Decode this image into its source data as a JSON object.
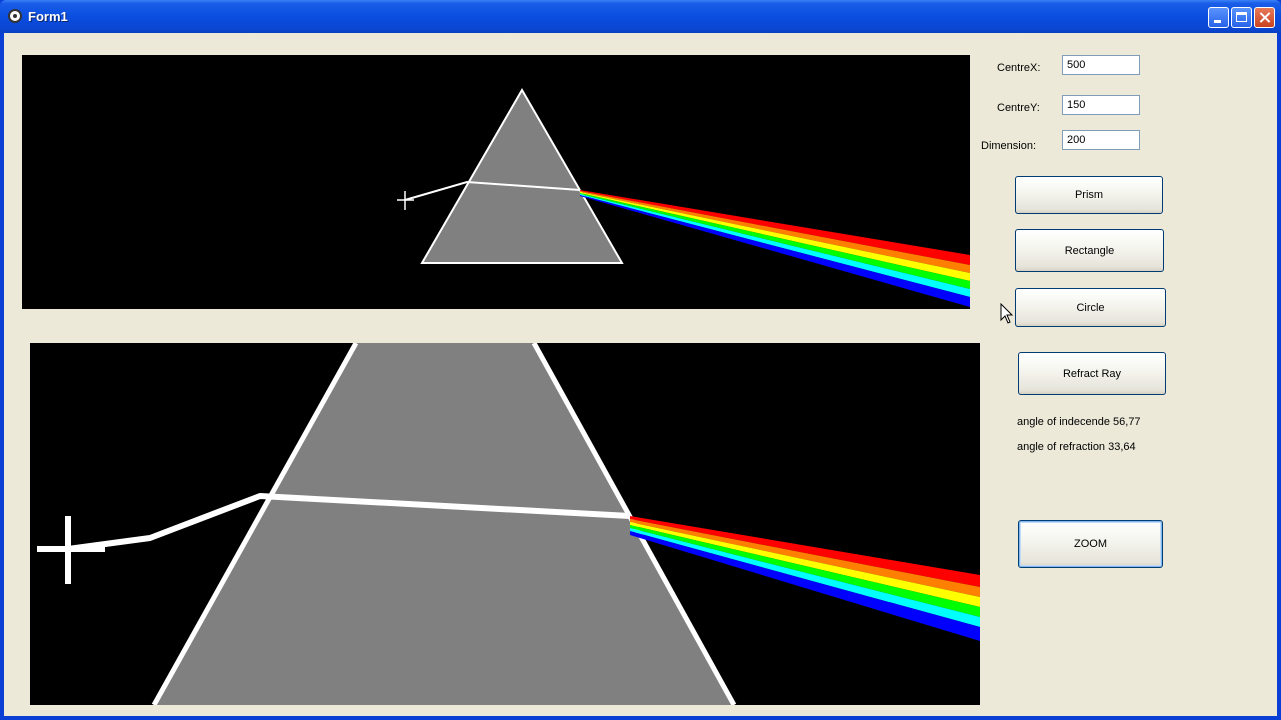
{
  "window": {
    "title": "Form1"
  },
  "icons": {
    "app": "app-icon",
    "minimize": "minimize-icon",
    "maximize": "maximize-icon",
    "close": "close-icon",
    "cursor": "mouse-pointer-icon"
  },
  "colors": {
    "canvas_background": "#000000",
    "prism_fill": "#808080",
    "prism_outline": "#ffffff",
    "ray": "#ffffff",
    "spectrum": [
      "#ff0000",
      "#ff8000",
      "#ffff00",
      "#00ff00",
      "#00ffff",
      "#0000ff"
    ]
  },
  "controls": {
    "centre_x": {
      "label": "CentreX:",
      "value": "500"
    },
    "centre_y": {
      "label": "CentreY:",
      "value": "150"
    },
    "dimension": {
      "label": "Dimension:",
      "value": "200"
    }
  },
  "buttons": {
    "prism": "Prism",
    "rectangle": "Rectangle",
    "circle": "Circle",
    "refract_ray": "Refract Ray",
    "zoom": "ZOOM"
  },
  "results": {
    "incidence": "angle of indecende 56,77",
    "refraction": "angle of refraction 33,64"
  }
}
